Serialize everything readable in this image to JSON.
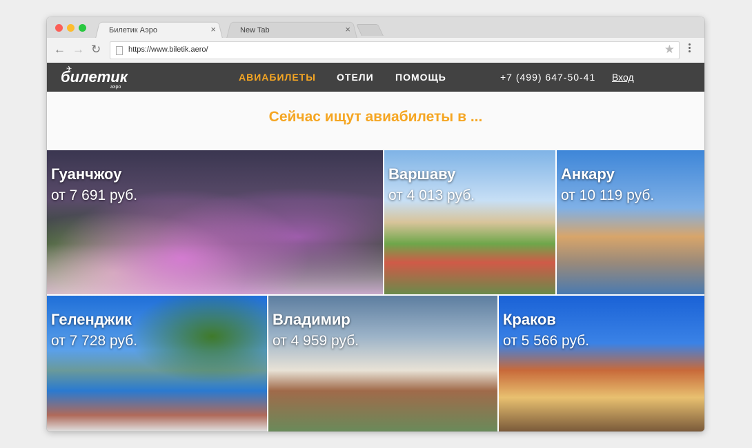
{
  "browser": {
    "tabs": [
      {
        "title": "Билетик Аэро",
        "active": true
      },
      {
        "title": "New Tab",
        "active": false
      }
    ],
    "url": "https://www.biletik.aero/",
    "close_glyph": "×",
    "back_glyph": "←",
    "forward_glyph": "→",
    "reload_glyph": "↻",
    "star_glyph": "★"
  },
  "site": {
    "logo": "билетик",
    "logo_sub": "аэро",
    "nav": [
      {
        "label": "АВИАБИЛЕТЫ",
        "active": true
      },
      {
        "label": "ОТЕЛИ",
        "active": false
      },
      {
        "label": "ПОМОЩЬ",
        "active": false
      }
    ],
    "phone": "+7 (499) 647-50-41",
    "login": "Вход",
    "headline": "Сейчас ищут авиабилеты в ...",
    "accent_color": "#f5a623",
    "header_color": "#424242"
  },
  "destinations": [
    {
      "city": "Гуанчжоу",
      "price": "от 7 691 руб."
    },
    {
      "city": "Варшаву",
      "price": "от 4 013 руб."
    },
    {
      "city": "Анкару",
      "price": "от 10 119 руб."
    },
    {
      "city": "Геленджик",
      "price": "от 7 728 руб."
    },
    {
      "city": "Владимир",
      "price": "от 4 959 руб."
    },
    {
      "city": "Краков",
      "price": "от 5 566 руб."
    }
  ]
}
